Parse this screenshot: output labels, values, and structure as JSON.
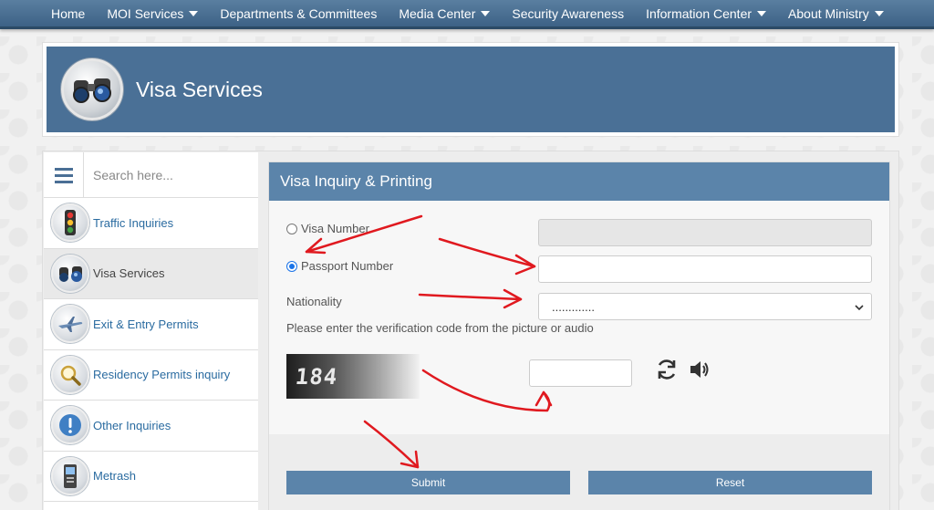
{
  "nav": {
    "items": [
      {
        "label": "Home",
        "dropdown": false
      },
      {
        "label": "MOI Services",
        "dropdown": true
      },
      {
        "label": "Departments & Committees",
        "dropdown": false
      },
      {
        "label": "Media Center",
        "dropdown": true
      },
      {
        "label": "Security Awareness",
        "dropdown": false
      },
      {
        "label": "Information Center",
        "dropdown": true
      },
      {
        "label": "About Ministry",
        "dropdown": true
      }
    ]
  },
  "banner": {
    "title": "Visa Services",
    "icon": "binoculars-icon"
  },
  "sidebar": {
    "search_placeholder": "Search here...",
    "items": [
      {
        "label": "Traffic Inquiries",
        "icon": "traffic-light-icon",
        "active": false
      },
      {
        "label": "Visa Services",
        "icon": "binoculars-icon",
        "active": true
      },
      {
        "label": "Exit & Entry Permits",
        "icon": "airplane-icon",
        "active": false
      },
      {
        "label": "Residency Permits inquiry",
        "icon": "magnifier-icon",
        "active": false
      },
      {
        "label": "Other Inquiries",
        "icon": "exclamation-icon",
        "active": false
      },
      {
        "label": "Metrash",
        "icon": "kiosk-icon",
        "active": false
      }
    ]
  },
  "panel": {
    "title": "Visa Inquiry & Printing",
    "visa_number_label": "Visa Number",
    "passport_number_label": "Passport Number",
    "selected_option": "Passport Number",
    "nationality_label": "Nationality",
    "nationality_value": ".............",
    "hint": "Please enter the verification code from the picture or audio",
    "captcha_text": "184",
    "submit_label": "Submit",
    "reset_label": "Reset"
  },
  "colors": {
    "nav_bg": "#4a7096",
    "panel_header": "#5b84aa",
    "link": "#2a6ba0",
    "annotation_arrow": "#e0191f"
  }
}
